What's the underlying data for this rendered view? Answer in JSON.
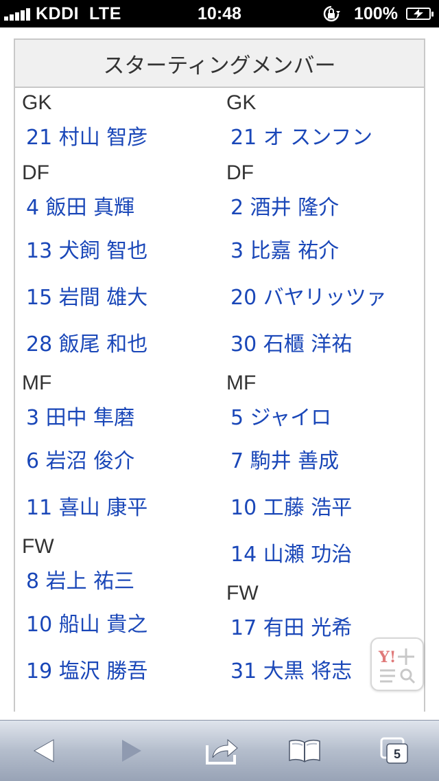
{
  "status_bar": {
    "carrier": "KDDI",
    "network": "LTE",
    "time": "10:48",
    "battery_percent": "100%"
  },
  "table": {
    "title": "スターティングメンバー",
    "left_team": {
      "groups": [
        {
          "position": "GK",
          "players": [
            "21 村山 智彦"
          ]
        },
        {
          "position": "DF",
          "players": [
            "4 飯田 真輝",
            "13 犬飼 智也",
            "15 岩間 雄大",
            "28 飯尾 和也"
          ]
        },
        {
          "position": "MF",
          "players": [
            "3 田中 隼磨",
            "6 岩沼 俊介",
            "11 喜山 康平"
          ]
        },
        {
          "position": "FW",
          "players": [
            "8 岩上 祐三",
            "10 船山 貴之",
            "19 塩沢 勝吾"
          ]
        }
      ]
    },
    "right_team": {
      "groups": [
        {
          "position": "GK",
          "players": [
            "21 オ スンフン"
          ]
        },
        {
          "position": "DF",
          "players": [
            "2 酒井 隆介",
            "3 比嘉 祐介",
            "20 バヤリッツァ",
            "30 石櫃 洋祐"
          ]
        },
        {
          "position": "MF",
          "players": [
            "5 ジャイロ",
            "7 駒井 善成",
            "10 工藤 浩平",
            "14 山瀬 功治"
          ]
        },
        {
          "position": "FW",
          "players": [
            "17 有田 光希",
            "31 大黒 将志"
          ]
        }
      ]
    }
  },
  "toolbar": {
    "tab_count": "5",
    "icons": [
      "back-icon",
      "forward-icon",
      "share-icon",
      "bookmarks-icon",
      "tabs-icon"
    ]
  },
  "colors": {
    "link": "#1a47b8",
    "header_bg": "#f0f0f0",
    "toolbar": "#b4bdcc"
  }
}
